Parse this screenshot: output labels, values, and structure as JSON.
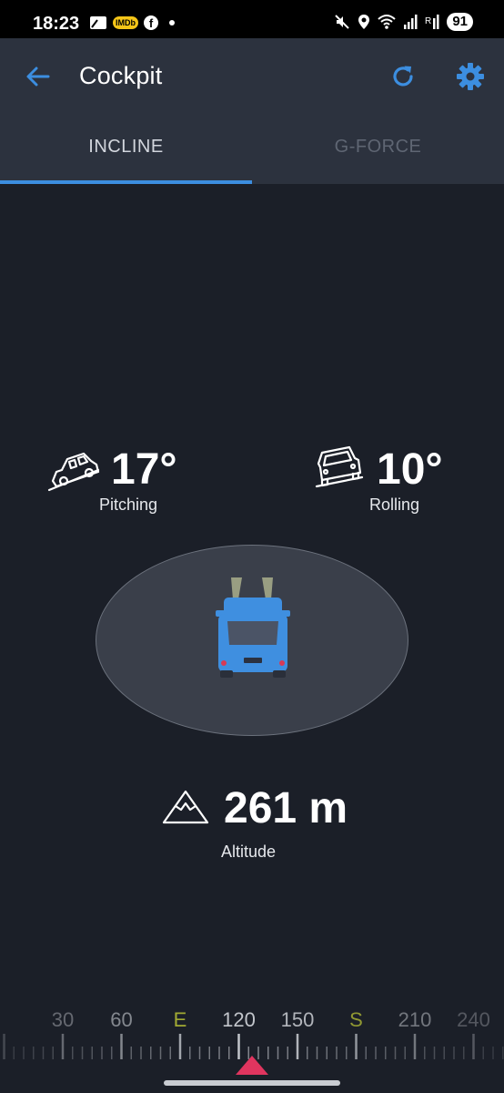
{
  "status_bar": {
    "time": "18:23",
    "imdb_label": "IMDb",
    "facebook_label": "f",
    "battery": "91"
  },
  "app_bar": {
    "title": "Cockpit",
    "icons": [
      "back-arrow-icon",
      "refresh-icon",
      "settings-gear-icon"
    ],
    "accent_color": "#3c8ee0"
  },
  "tabs": [
    {
      "label": "INCLINE",
      "selected": true
    },
    {
      "label": "G-FORCE",
      "selected": false
    }
  ],
  "pitching": {
    "value": "17°",
    "label": "Pitching"
  },
  "rolling": {
    "value": "10°",
    "label": "Rolling"
  },
  "altitude": {
    "value": "261 m",
    "label": "Altitude"
  },
  "compass": {
    "labels": [
      "30",
      "60",
      "E",
      "120",
      "150",
      "S",
      "210",
      "240"
    ],
    "cardinal_color": "#c7d137",
    "heading_marker_color": "#e0355f"
  }
}
